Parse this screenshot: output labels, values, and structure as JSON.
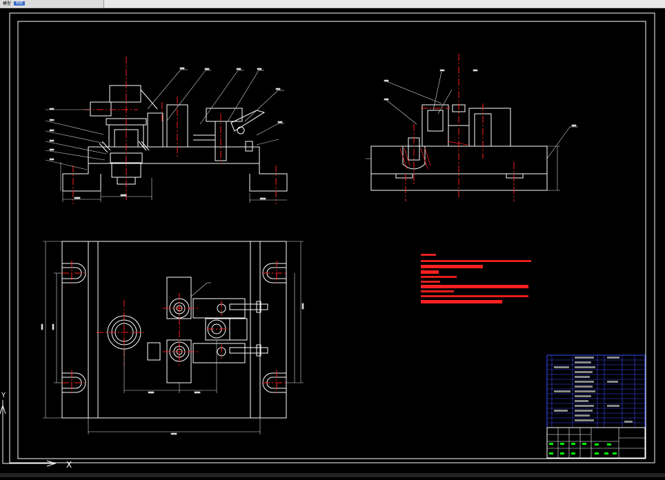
{
  "window": {
    "tab_label": "模型",
    "layout_tab": "布局"
  },
  "ucs": {
    "x_label": "X",
    "y_label": "Y"
  },
  "colors": {
    "background": "#000000",
    "outline": "#ffffff",
    "centerline": "#ff2020",
    "dimension": "#ffffff",
    "text_red": "#ff2020",
    "table_blue": "#3a4cff",
    "table_green": "#00ff00"
  },
  "icons": [
    "ucs-icon"
  ]
}
